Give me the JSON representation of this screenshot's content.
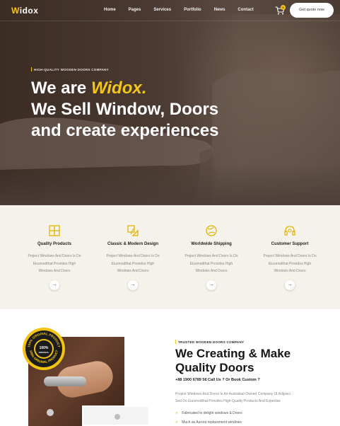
{
  "nav": {
    "logo_w": "W",
    "logo_rest": "idox",
    "links": [
      "Home",
      "Pages",
      "Services",
      "Portfolio",
      "News",
      "Contact"
    ],
    "cart_count": "0",
    "quote_label": "Get quote now"
  },
  "hero": {
    "tag": "HIGH-QUALITY WOODEN DOORS COMPANY",
    "line1_prefix": "We are ",
    "line1_brand": "Widox.",
    "line2": "We Sell Window, Doors",
    "line3": "and create experiences"
  },
  "features": [
    {
      "icon": "window-icon",
      "title": "Quality Products",
      "desc1": "Project Windows And Doors Is Do",
      "desc2": "Eiusmodthat Provides High",
      "desc3": "Windows And Doors",
      "arrow": "→"
    },
    {
      "icon": "design-tools-icon",
      "title": "Classic & Modern Design",
      "desc1": "Project Windows And Doors Is Do",
      "desc2": "Eiusmodthat Provides High",
      "desc3": "Windows And Doors",
      "arrow": "→"
    },
    {
      "icon": "globe-icon",
      "title": "Worldwide Shipping",
      "desc1": "Project Windows And Doors Is Do",
      "desc2": "Eiusmodthat Provides High",
      "desc3": "Windows And Doors",
      "arrow": "→"
    },
    {
      "icon": "headset-icon",
      "title": "Customer Support",
      "desc1": "Project Windows And Doors Is Do",
      "desc2": "Eiusmodthat Provides High",
      "desc3": "Windows And Doors",
      "arrow": "→"
    }
  ],
  "badge": {
    "top_text": "100% ORIGINAL PRODUCT",
    "center_big": "100%",
    "center_small": "ORIGINAL",
    "bottom_text": "100% ORIGINAL PRODUCT"
  },
  "about": {
    "tag": "TRUSTED WOODEN DOORS COMPANY",
    "title1": "We Creating & Make",
    "title2": "Quality Doors",
    "phone": "+88 1900 6789 56 Call Us ? Or Book Custom ?",
    "desc1": "Project Windows And Doors Is An Australian-Owned Company Ut Adipisci",
    "desc2": "Sed Do Eiusmodthat Provides High-Quality Products And Expertise",
    "checks": [
      "Fabricated to delight windows & Doors",
      "Much as Aurora replacement windows"
    ]
  },
  "colors": {
    "accent": "#f5c518",
    "hero_bg": "#4a3a31",
    "features_bg": "#f4f2ea"
  }
}
